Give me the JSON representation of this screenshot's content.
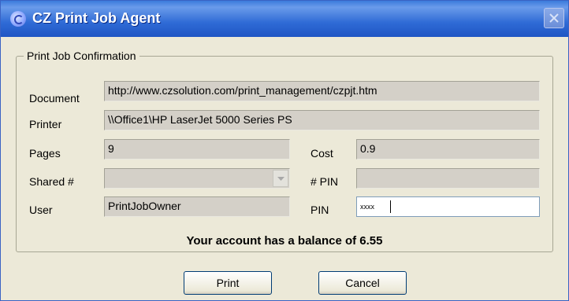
{
  "window": {
    "title": "CZ Print Job Agent"
  },
  "group": {
    "legend": "Print Job Confirmation"
  },
  "fields": {
    "document": {
      "label": "Document",
      "value": "http://www.czsolution.com/print_management/czpjt.htm"
    },
    "printer": {
      "label": "Printer",
      "value": "\\\\Office1\\HP LaserJet 5000 Series PS"
    },
    "pages": {
      "label": "Pages",
      "value": "9"
    },
    "cost": {
      "label": "Cost",
      "value": "0.9"
    },
    "shared": {
      "label": "Shared #",
      "value": ""
    },
    "hash_pin": {
      "label": "# PIN",
      "value": ""
    },
    "user": {
      "label": "User",
      "value": "PrintJobOwner"
    },
    "pin": {
      "label": "PIN",
      "value": "xxxx"
    }
  },
  "balance_text": "Your account has a balance of 6.55",
  "buttons": {
    "print": "Print",
    "cancel": "Cancel"
  },
  "icons": {
    "app": "print-agent-icon",
    "close": "close-icon",
    "dropdown": "chevron-down-icon"
  }
}
